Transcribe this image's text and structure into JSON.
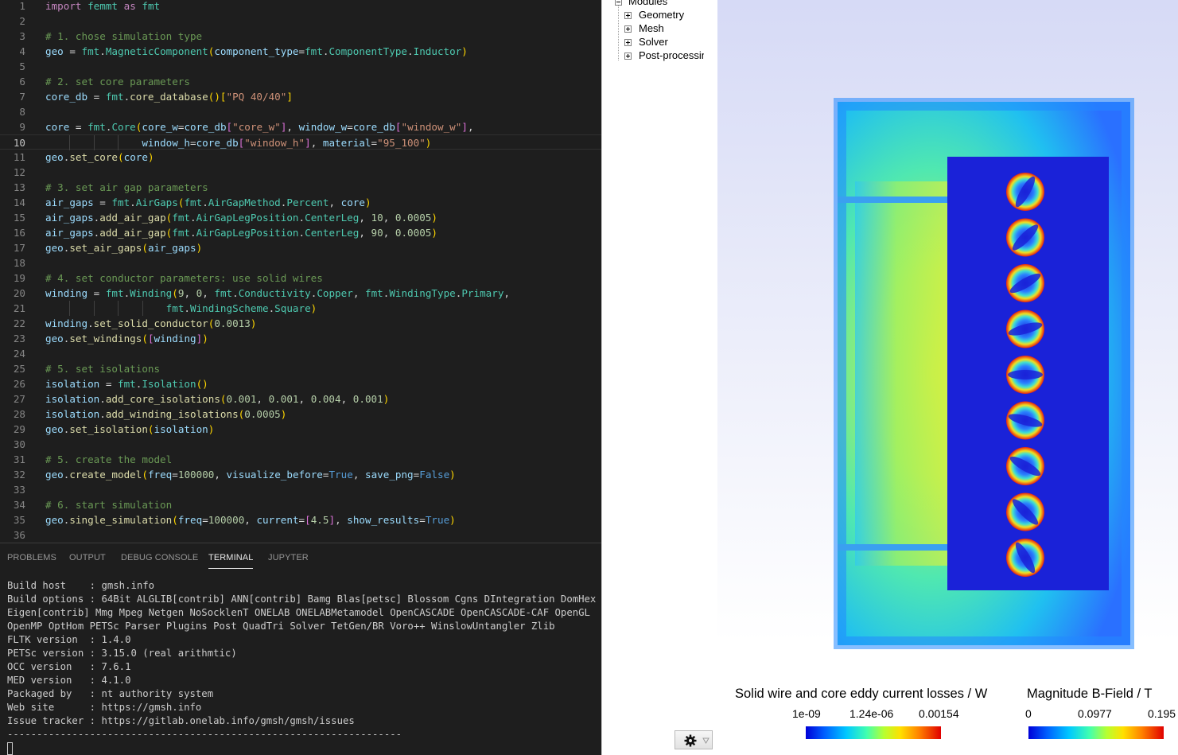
{
  "editor": {
    "current_line": 10,
    "lines": [
      {
        "n": "1",
        "t": [
          [
            "t-kw",
            "import"
          ],
          [
            "t-op",
            " "
          ],
          [
            "t-mod",
            "femmt"
          ],
          [
            "t-op",
            " "
          ],
          [
            "t-kw",
            "as"
          ],
          [
            "t-op",
            " "
          ],
          [
            "t-mod",
            "fmt"
          ]
        ]
      },
      {
        "n": "2",
        "t": []
      },
      {
        "n": "3",
        "t": [
          [
            "t-cm",
            "# 1. chose simulation type"
          ]
        ]
      },
      {
        "n": "4",
        "t": [
          [
            "t-var",
            "geo"
          ],
          [
            "t-op",
            " = "
          ],
          [
            "t-mod",
            "fmt"
          ],
          [
            "t-op",
            "."
          ],
          [
            "t-mod",
            "MagneticComponent"
          ],
          [
            "t-br1",
            "("
          ],
          [
            "t-var",
            "component_type"
          ],
          [
            "t-op",
            "="
          ],
          [
            "t-mod",
            "fmt"
          ],
          [
            "t-op",
            "."
          ],
          [
            "t-mod",
            "ComponentType"
          ],
          [
            "t-op",
            "."
          ],
          [
            "t-mod",
            "Inductor"
          ],
          [
            "t-br1",
            ")"
          ]
        ]
      },
      {
        "n": "5",
        "t": []
      },
      {
        "n": "6",
        "t": [
          [
            "t-cm",
            "# 2. set core parameters"
          ]
        ]
      },
      {
        "n": "7",
        "t": [
          [
            "t-var",
            "core_db"
          ],
          [
            "t-op",
            " = "
          ],
          [
            "t-mod",
            "fmt"
          ],
          [
            "t-op",
            "."
          ],
          [
            "t-fn",
            "core_database"
          ],
          [
            "t-br1",
            "()"
          ],
          [
            "t-br1",
            "["
          ],
          [
            "t-str",
            "\"PQ 40/40\""
          ],
          [
            "t-br1",
            "]"
          ]
        ]
      },
      {
        "n": "8",
        "t": []
      },
      {
        "n": "9",
        "t": [
          [
            "t-var",
            "core"
          ],
          [
            "t-op",
            " = "
          ],
          [
            "t-mod",
            "fmt"
          ],
          [
            "t-op",
            "."
          ],
          [
            "t-mod",
            "Core"
          ],
          [
            "t-br1",
            "("
          ],
          [
            "t-var",
            "core_w"
          ],
          [
            "t-op",
            "="
          ],
          [
            "t-var",
            "core_db"
          ],
          [
            "t-br2",
            "["
          ],
          [
            "t-str",
            "\"core_w\""
          ],
          [
            "t-br2",
            "]"
          ],
          [
            "t-op",
            ", "
          ],
          [
            "t-var",
            "window_w"
          ],
          [
            "t-op",
            "="
          ],
          [
            "t-var",
            "core_db"
          ],
          [
            "t-br2",
            "["
          ],
          [
            "t-str",
            "\"window_w\""
          ],
          [
            "t-br2",
            "]"
          ],
          [
            "t-op",
            ","
          ]
        ]
      },
      {
        "n": "10",
        "t": [
          [
            "t-op",
            "                "
          ],
          [
            "t-var",
            "window_h"
          ],
          [
            "t-op",
            "="
          ],
          [
            "t-var",
            "core_db"
          ],
          [
            "t-br2",
            "["
          ],
          [
            "t-str",
            "\"window_h\""
          ],
          [
            "t-br2",
            "]"
          ],
          [
            "t-op",
            ", "
          ],
          [
            "t-var",
            "material"
          ],
          [
            "t-op",
            "="
          ],
          [
            "t-str",
            "\"95_100\""
          ],
          [
            "t-br1",
            ")"
          ]
        ]
      },
      {
        "n": "11",
        "t": [
          [
            "t-var",
            "geo"
          ],
          [
            "t-op",
            "."
          ],
          [
            "t-fn",
            "set_core"
          ],
          [
            "t-br1",
            "("
          ],
          [
            "t-var",
            "core"
          ],
          [
            "t-br1",
            ")"
          ]
        ]
      },
      {
        "n": "12",
        "t": []
      },
      {
        "n": "13",
        "t": [
          [
            "t-cm",
            "# 3. set air gap parameters"
          ]
        ]
      },
      {
        "n": "14",
        "t": [
          [
            "t-var",
            "air_gaps"
          ],
          [
            "t-op",
            " = "
          ],
          [
            "t-mod",
            "fmt"
          ],
          [
            "t-op",
            "."
          ],
          [
            "t-mod",
            "AirGaps"
          ],
          [
            "t-br1",
            "("
          ],
          [
            "t-mod",
            "fmt"
          ],
          [
            "t-op",
            "."
          ],
          [
            "t-mod",
            "AirGapMethod"
          ],
          [
            "t-op",
            "."
          ],
          [
            "t-mod",
            "Percent"
          ],
          [
            "t-op",
            ", "
          ],
          [
            "t-var",
            "core"
          ],
          [
            "t-br1",
            ")"
          ]
        ]
      },
      {
        "n": "15",
        "t": [
          [
            "t-var",
            "air_gaps"
          ],
          [
            "t-op",
            "."
          ],
          [
            "t-fn",
            "add_air_gap"
          ],
          [
            "t-br1",
            "("
          ],
          [
            "t-mod",
            "fmt"
          ],
          [
            "t-op",
            "."
          ],
          [
            "t-mod",
            "AirGapLegPosition"
          ],
          [
            "t-op",
            "."
          ],
          [
            "t-mod",
            "CenterLeg"
          ],
          [
            "t-op",
            ", "
          ],
          [
            "t-num",
            "10"
          ],
          [
            "t-op",
            ", "
          ],
          [
            "t-num",
            "0.0005"
          ],
          [
            "t-br1",
            ")"
          ]
        ]
      },
      {
        "n": "16",
        "t": [
          [
            "t-var",
            "air_gaps"
          ],
          [
            "t-op",
            "."
          ],
          [
            "t-fn",
            "add_air_gap"
          ],
          [
            "t-br1",
            "("
          ],
          [
            "t-mod",
            "fmt"
          ],
          [
            "t-op",
            "."
          ],
          [
            "t-mod",
            "AirGapLegPosition"
          ],
          [
            "t-op",
            "."
          ],
          [
            "t-mod",
            "CenterLeg"
          ],
          [
            "t-op",
            ", "
          ],
          [
            "t-num",
            "90"
          ],
          [
            "t-op",
            ", "
          ],
          [
            "t-num",
            "0.0005"
          ],
          [
            "t-br1",
            ")"
          ]
        ]
      },
      {
        "n": "17",
        "t": [
          [
            "t-var",
            "geo"
          ],
          [
            "t-op",
            "."
          ],
          [
            "t-fn",
            "set_air_gaps"
          ],
          [
            "t-br1",
            "("
          ],
          [
            "t-var",
            "air_gaps"
          ],
          [
            "t-br1",
            ")"
          ]
        ]
      },
      {
        "n": "18",
        "t": []
      },
      {
        "n": "19",
        "t": [
          [
            "t-cm",
            "# 4. set conductor parameters: use solid wires"
          ]
        ]
      },
      {
        "n": "20",
        "t": [
          [
            "t-var",
            "winding"
          ],
          [
            "t-op",
            " = "
          ],
          [
            "t-mod",
            "fmt"
          ],
          [
            "t-op",
            "."
          ],
          [
            "t-mod",
            "Winding"
          ],
          [
            "t-br1",
            "("
          ],
          [
            "t-num",
            "9"
          ],
          [
            "t-op",
            ", "
          ],
          [
            "t-num",
            "0"
          ],
          [
            "t-op",
            ", "
          ],
          [
            "t-mod",
            "fmt"
          ],
          [
            "t-op",
            "."
          ],
          [
            "t-mod",
            "Conductivity"
          ],
          [
            "t-op",
            "."
          ],
          [
            "t-mod",
            "Copper"
          ],
          [
            "t-op",
            ", "
          ],
          [
            "t-mod",
            "fmt"
          ],
          [
            "t-op",
            "."
          ],
          [
            "t-mod",
            "WindingType"
          ],
          [
            "t-op",
            "."
          ],
          [
            "t-mod",
            "Primary"
          ],
          [
            "t-op",
            ","
          ]
        ]
      },
      {
        "n": "21",
        "t": [
          [
            "t-op",
            "                    "
          ],
          [
            "t-mod",
            "fmt"
          ],
          [
            "t-op",
            "."
          ],
          [
            "t-mod",
            "WindingScheme"
          ],
          [
            "t-op",
            "."
          ],
          [
            "t-mod",
            "Square"
          ],
          [
            "t-br1",
            ")"
          ]
        ]
      },
      {
        "n": "22",
        "t": [
          [
            "t-var",
            "winding"
          ],
          [
            "t-op",
            "."
          ],
          [
            "t-fn",
            "set_solid_conductor"
          ],
          [
            "t-br1",
            "("
          ],
          [
            "t-num",
            "0.0013"
          ],
          [
            "t-br1",
            ")"
          ]
        ]
      },
      {
        "n": "23",
        "t": [
          [
            "t-var",
            "geo"
          ],
          [
            "t-op",
            "."
          ],
          [
            "t-fn",
            "set_windings"
          ],
          [
            "t-br1",
            "("
          ],
          [
            "t-br2",
            "["
          ],
          [
            "t-var",
            "winding"
          ],
          [
            "t-br2",
            "]"
          ],
          [
            "t-br1",
            ")"
          ]
        ]
      },
      {
        "n": "24",
        "t": []
      },
      {
        "n": "25",
        "t": [
          [
            "t-cm",
            "# 5. set isolations"
          ]
        ]
      },
      {
        "n": "26",
        "t": [
          [
            "t-var",
            "isolation"
          ],
          [
            "t-op",
            " = "
          ],
          [
            "t-mod",
            "fmt"
          ],
          [
            "t-op",
            "."
          ],
          [
            "t-mod",
            "Isolation"
          ],
          [
            "t-br1",
            "()"
          ]
        ]
      },
      {
        "n": "27",
        "t": [
          [
            "t-var",
            "isolation"
          ],
          [
            "t-op",
            "."
          ],
          [
            "t-fn",
            "add_core_isolations"
          ],
          [
            "t-br1",
            "("
          ],
          [
            "t-num",
            "0.001"
          ],
          [
            "t-op",
            ", "
          ],
          [
            "t-num",
            "0.001"
          ],
          [
            "t-op",
            ", "
          ],
          [
            "t-num",
            "0.004"
          ],
          [
            "t-op",
            ", "
          ],
          [
            "t-num",
            "0.001"
          ],
          [
            "t-br1",
            ")"
          ]
        ]
      },
      {
        "n": "28",
        "t": [
          [
            "t-var",
            "isolation"
          ],
          [
            "t-op",
            "."
          ],
          [
            "t-fn",
            "add_winding_isolations"
          ],
          [
            "t-br1",
            "("
          ],
          [
            "t-num",
            "0.0005"
          ],
          [
            "t-br1",
            ")"
          ]
        ]
      },
      {
        "n": "29",
        "t": [
          [
            "t-var",
            "geo"
          ],
          [
            "t-op",
            "."
          ],
          [
            "t-fn",
            "set_isolation"
          ],
          [
            "t-br1",
            "("
          ],
          [
            "t-var",
            "isolation"
          ],
          [
            "t-br1",
            ")"
          ]
        ]
      },
      {
        "n": "30",
        "t": []
      },
      {
        "n": "31",
        "t": [
          [
            "t-cm",
            "# 5. create the model"
          ]
        ]
      },
      {
        "n": "32",
        "t": [
          [
            "t-var",
            "geo"
          ],
          [
            "t-op",
            "."
          ],
          [
            "t-fn",
            "create_model"
          ],
          [
            "t-br1",
            "("
          ],
          [
            "t-var",
            "freq"
          ],
          [
            "t-op",
            "="
          ],
          [
            "t-num",
            "100000"
          ],
          [
            "t-op",
            ", "
          ],
          [
            "t-var",
            "visualize_before"
          ],
          [
            "t-op",
            "="
          ],
          [
            "t-bool",
            "True"
          ],
          [
            "t-op",
            ", "
          ],
          [
            "t-var",
            "save_png"
          ],
          [
            "t-op",
            "="
          ],
          [
            "t-bool",
            "False"
          ],
          [
            "t-br1",
            ")"
          ]
        ]
      },
      {
        "n": "33",
        "t": []
      },
      {
        "n": "34",
        "t": [
          [
            "t-cm",
            "# 6. start simulation"
          ]
        ]
      },
      {
        "n": "35",
        "t": [
          [
            "t-var",
            "geo"
          ],
          [
            "t-op",
            "."
          ],
          [
            "t-fn",
            "single_simulation"
          ],
          [
            "t-br1",
            "("
          ],
          [
            "t-var",
            "freq"
          ],
          [
            "t-op",
            "="
          ],
          [
            "t-num",
            "100000"
          ],
          [
            "t-op",
            ", "
          ],
          [
            "t-var",
            "current"
          ],
          [
            "t-op",
            "="
          ],
          [
            "t-br2",
            "["
          ],
          [
            "t-num",
            "4.5"
          ],
          [
            "t-br2",
            "]"
          ],
          [
            "t-op",
            ", "
          ],
          [
            "t-var",
            "show_results"
          ],
          [
            "t-op",
            "="
          ],
          [
            "t-bool",
            "True"
          ],
          [
            "t-br1",
            ")"
          ]
        ]
      },
      {
        "n": "36",
        "t": []
      }
    ]
  },
  "panel": {
    "tabs": [
      {
        "label": "PROBLEMS",
        "active": false
      },
      {
        "label": "OUTPUT",
        "active": false
      },
      {
        "label": "DEBUG CONSOLE",
        "active": false
      },
      {
        "label": "TERMINAL",
        "active": true
      },
      {
        "label": "JUPYTER",
        "active": false
      }
    ],
    "terminal_text": "Build host    : gmsh.info\nBuild options : 64Bit ALGLIB[contrib] ANN[contrib] Bamg Blas[petsc] Blossom Cgns DIntegration DomHex Eigen[contrib] Mmg Mpeg Netgen NoSocklenT ONELAB ONELABMetamodel OpenCASCADE OpenCASCADE-CAF OpenGL OpenMP OptHom PETSc Parser Plugins Post QuadTri Solver TetGen/BR Voro++ WinslowUntangler Zlib\nFLTK version  : 1.4.0\nPETSc version : 3.15.0 (real arithmtic)\nOCC version   : 7.6.1\nMED version   : 4.1.0\nPackaged by   : nt authority system\nWeb site      : https://gmsh.info\nIssue tracker : https://gitlab.onelab.info/gmsh/gmsh/issues\n-------------------------------------------------------------------"
  },
  "tree": {
    "root": "Modules",
    "items": [
      "Geometry",
      "Mesh",
      "Solver",
      "Post-processing"
    ]
  },
  "view": {
    "wire_count": 9,
    "colorbars": [
      {
        "title": "Solid wire and core eddy current losses / W",
        "labels": [
          "1e-09",
          "1.24e-06",
          "0.00154"
        ]
      },
      {
        "title": "Magnitude B-Field / T",
        "labels": [
          "0",
          "0.0977",
          "0.195"
        ]
      }
    ],
    "colors": {
      "deep_blue": "#1a22d8",
      "core_edge": "#2288ff",
      "core_mid": "#44e0c0",
      "core_hot": "#b8f050",
      "gap": "#3aa0f0"
    }
  },
  "toolbar": {
    "gear_icon": "gear-icon",
    "dropdown_icon": "triangle-down-icon"
  }
}
